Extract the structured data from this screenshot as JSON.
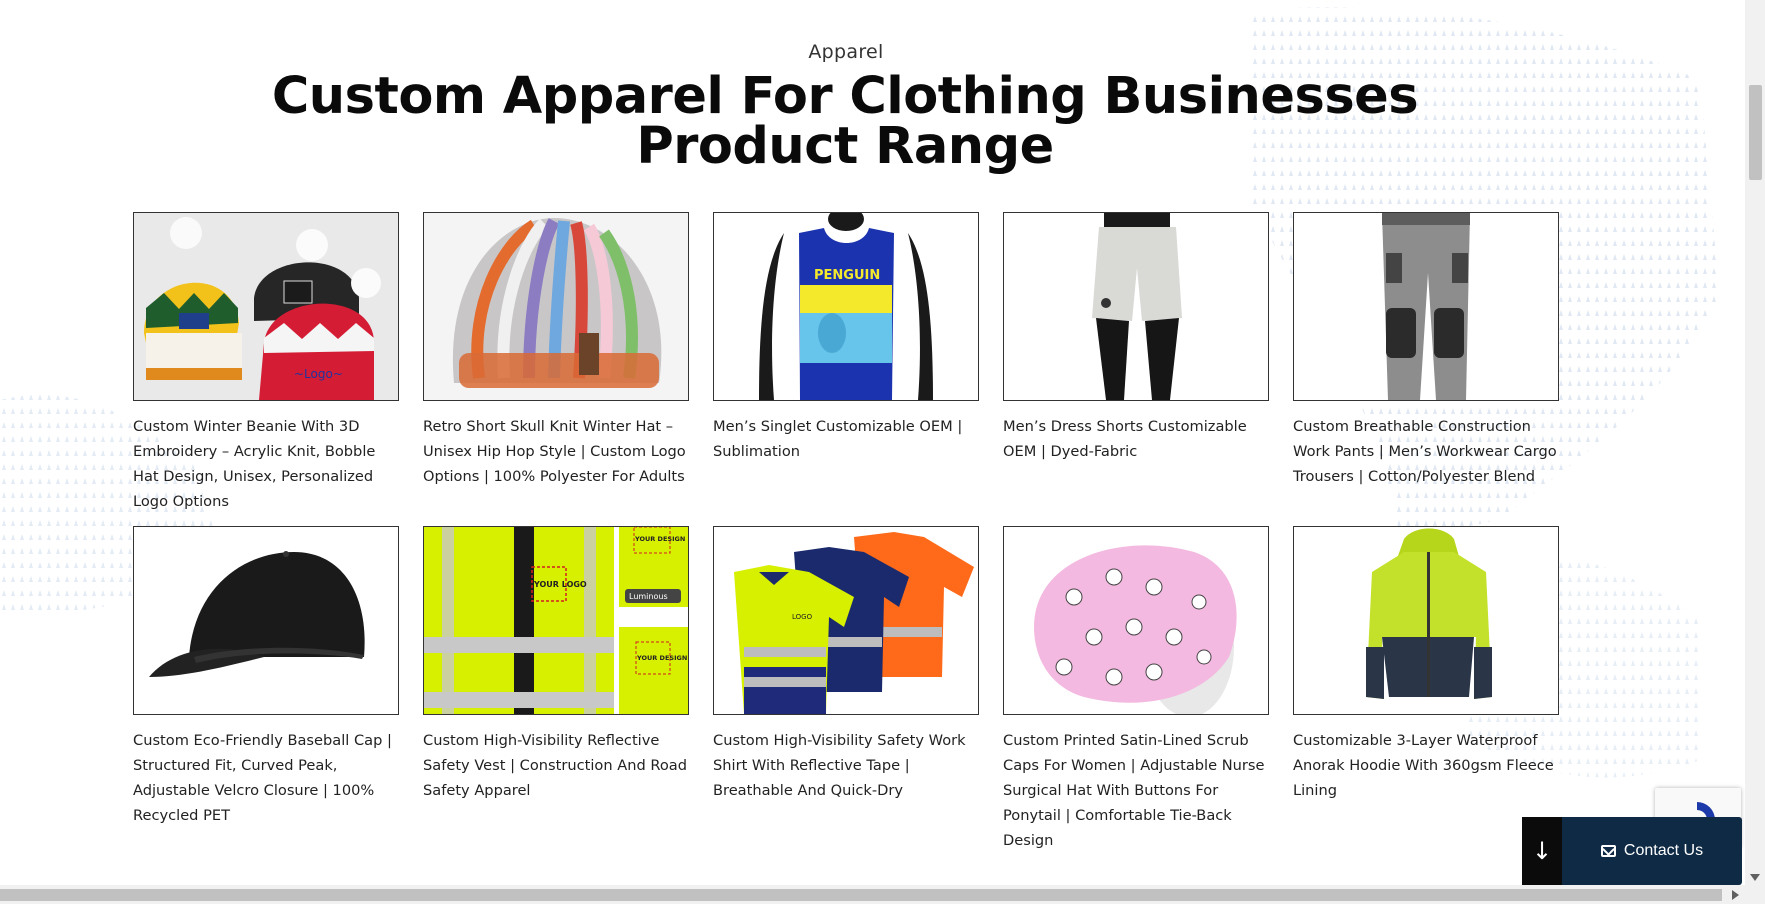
{
  "section": {
    "eyebrow": "Apparel",
    "title": "Custom Apparel For Clothing Businesses Product Range"
  },
  "products": [
    {
      "caption": "Custom Winter Beanie With 3D Embroidery – Acrylic Knit, Bobble Hat Design, Unisex, Personalized Logo Options"
    },
    {
      "caption": "Retro Short Skull Knit Winter Hat – Unisex Hip Hop Style | Custom Logo Options | 100% Polyester For Adults"
    },
    {
      "caption": "Men’s Singlet Customizable OEM | Sublimation"
    },
    {
      "caption": "Men’s Dress Shorts Customizable OEM | Dyed-Fabric"
    },
    {
      "caption": "Custom Breathable Construction Work Pants | Men’s Workwear Cargo Trousers | Cotton/Polyester Blend"
    },
    {
      "caption": "Custom Eco-Friendly Baseball Cap | Structured Fit, Curved Peak, Adjustable Velcro Closure | 100% Recycled PET"
    },
    {
      "caption": "Custom High-Visibility Reflective Safety Vest | Construction And Road Safety Apparel"
    },
    {
      "caption": "Custom High-Visibility Safety Work Shirt With Reflective Tape | Breathable And Quick-Dry"
    },
    {
      "caption": "Custom Printed Satin-Lined Scrub Caps For Women | Adjustable Nurse Surgical Hat With Buttons For Ponytail | Comfortable Tie-Back Design"
    },
    {
      "caption": "Customizable 3-Layer Waterproof Anorak Hoodie With 360gsm Fleece Lining"
    }
  ],
  "image_text": {
    "singlet_brand": "PENGUIN",
    "vest_logo": "YOUR LOGO",
    "vest_design": "YOUR DESIGN",
    "vest_luminous": "Luminous",
    "shirt_logo": "LOGO"
  },
  "widgets": {
    "contact_label": "Contact Us",
    "scroll_down_icon": "arrow-down-icon",
    "contact_icon": "envelope-icon"
  },
  "colors": {
    "contact_bg": "#0f2a45",
    "hi_vis_yellow": "#d7f000",
    "hi_vis_orange": "#ff6a1a"
  }
}
